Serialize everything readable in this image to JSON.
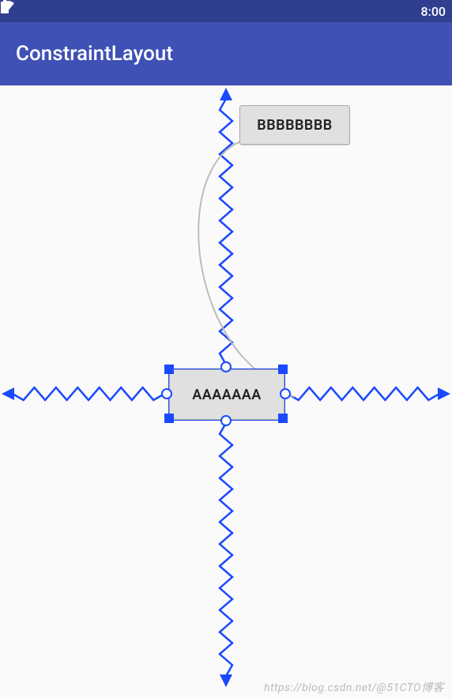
{
  "status_bar": {
    "time": "8:00"
  },
  "app_bar": {
    "title": "ConstraintLayout"
  },
  "widgets": {
    "a": {
      "label": "AAAAAAA",
      "selected": true
    },
    "b": {
      "label": "BBBBBBBB",
      "selected": false
    }
  },
  "icons": {
    "wifi": "wifi-icon",
    "battery": "battery-icon"
  },
  "colors": {
    "constraint": "#1a49ff",
    "curve": "#bcbcbc"
  },
  "watermark": "https://blog.csdn.net/@51CTO博客"
}
